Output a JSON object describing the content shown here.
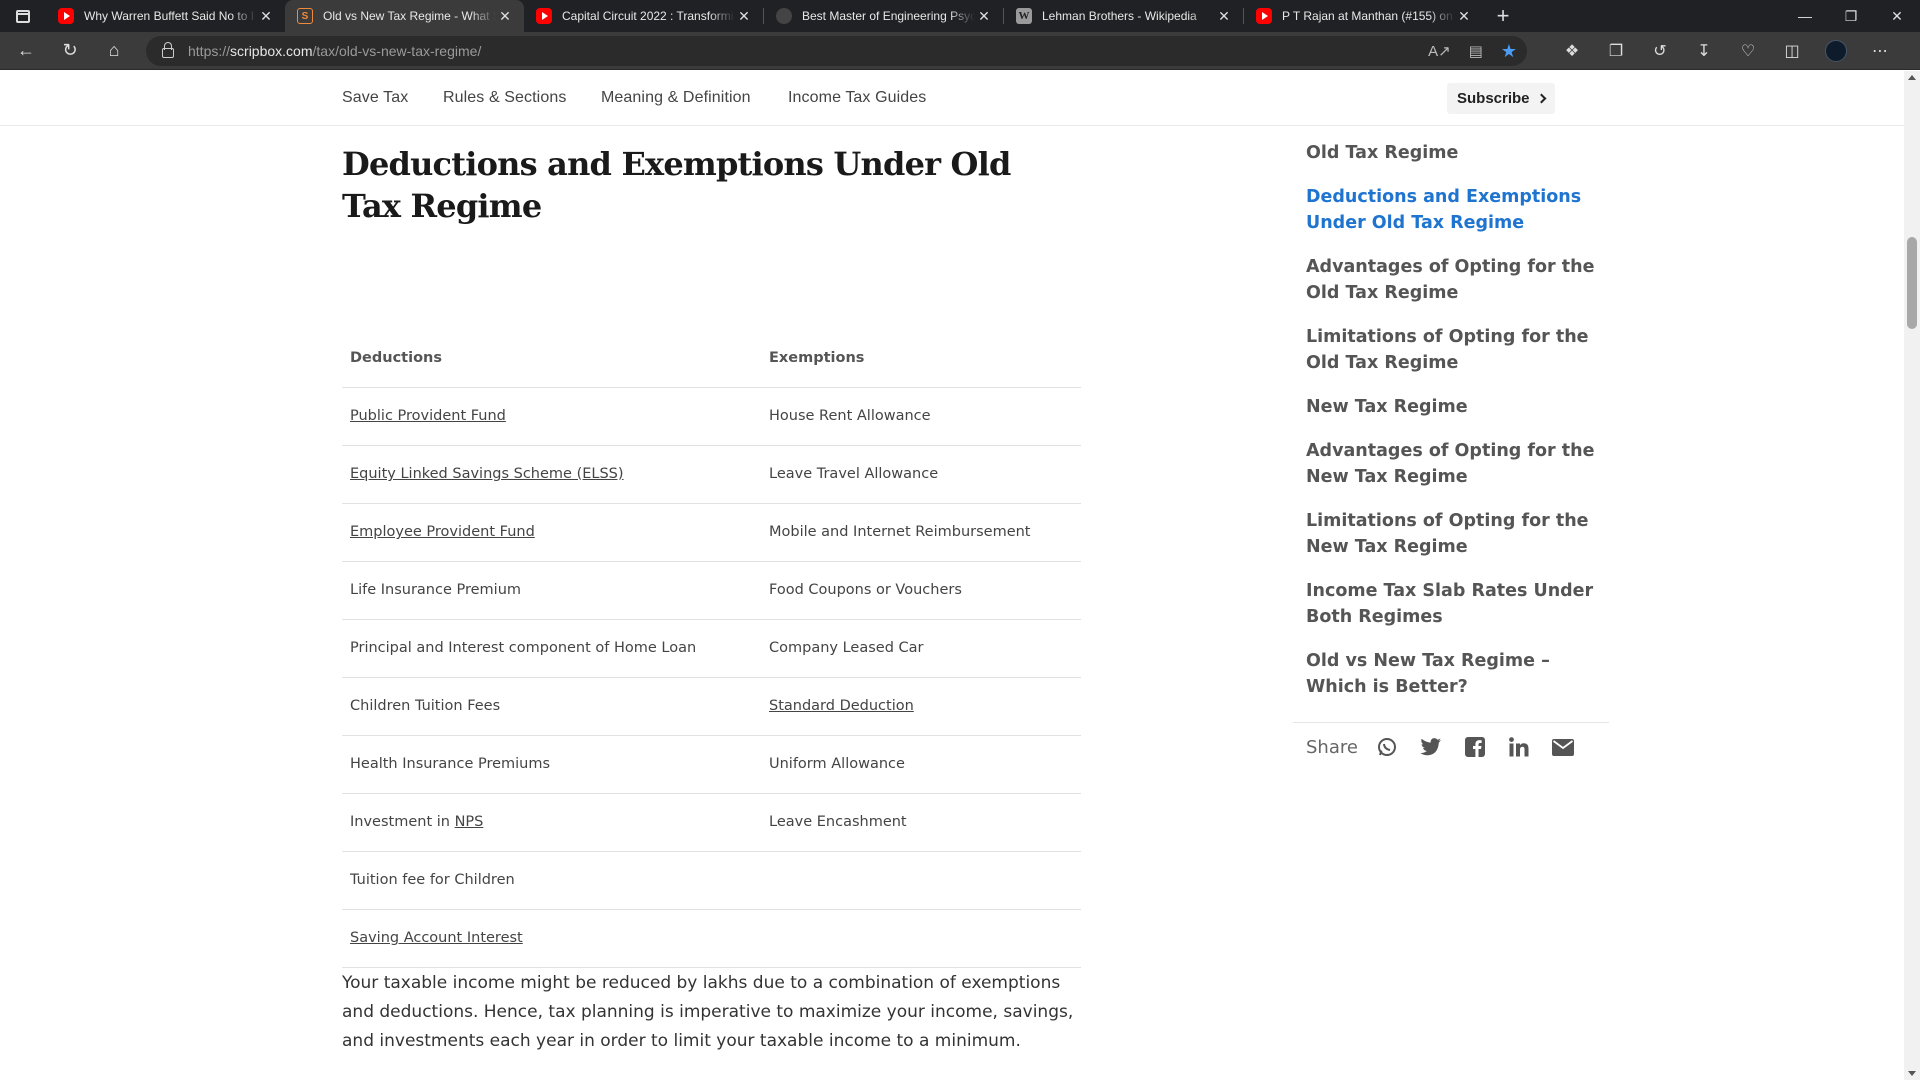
{
  "browser": {
    "tabs": [
      {
        "title": "Why Warren Buffett Said No to I",
        "favicon": "youtube-icon",
        "active": false
      },
      {
        "title": "Old vs New Tax Regime - What S",
        "favicon": "scripbox-icon",
        "active": true
      },
      {
        "title": "Capital Circuit 2022 : Transformi",
        "favicon": "youtube-icon",
        "active": false
      },
      {
        "title": "Best Master of Engineering Psych",
        "favicon": "site-icon",
        "active": false
      },
      {
        "title": "Lehman Brothers - Wikipedia",
        "favicon": "wikipedia-icon",
        "active": false
      },
      {
        "title": "P T Rajan at Manthan (#155) on",
        "favicon": "youtube-icon",
        "active": false
      }
    ],
    "url_prefix": "https://",
    "url_host": "scripbox.com",
    "url_path": "/tax/old-vs-new-tax-regime/",
    "colors": {
      "chrome_dark": "#202124",
      "chrome_mid": "#3b3b3b",
      "accent_star": "#4a9cf5"
    }
  },
  "site_nav": {
    "items": [
      "Save Tax",
      "Rules & Sections",
      "Meaning & Definition",
      "Income Tax Guides"
    ],
    "subscribe_label": "Subscribe"
  },
  "article": {
    "title": "Deductions and Exemptions Under Old Tax Regime",
    "table": {
      "headers": [
        "Deductions",
        "Exemptions"
      ],
      "rows": [
        {
          "deduction": "Public Provident Fund",
          "deduction_link": true,
          "exemption": "House Rent Allowance",
          "exemption_link": false
        },
        {
          "deduction": "Equity Linked Savings Scheme (ELSS)",
          "deduction_link": true,
          "exemption": "Leave Travel Allowance",
          "exemption_link": false
        },
        {
          "deduction": "Employee Provident Fund",
          "deduction_link": true,
          "exemption": "Mobile and Internet Reimbursement",
          "exemption_link": false
        },
        {
          "deduction": "Life Insurance Premium",
          "deduction_link": false,
          "exemption": "Food Coupons or Vouchers",
          "exemption_link": false
        },
        {
          "deduction": "Principal and Interest component of Home Loan",
          "deduction_link": false,
          "exemption": "Company Leased Car",
          "exemption_link": false
        },
        {
          "deduction": "Children Tuition Fees",
          "deduction_link": false,
          "exemption": "Standard Deduction",
          "exemption_link": true
        },
        {
          "deduction": "Health Insurance Premiums",
          "deduction_link": false,
          "exemption": "Uniform Allowance",
          "exemption_link": false
        },
        {
          "deduction_prefix": "Investment in ",
          "deduction": "NPS",
          "deduction_link": true,
          "exemption": "Leave Encashment",
          "exemption_link": false
        },
        {
          "deduction": "Tuition fee for Children",
          "deduction_link": false,
          "exemption": "",
          "exemption_link": false
        },
        {
          "deduction": "Saving Account Interest",
          "deduction_link": true,
          "exemption": "",
          "exemption_link": false
        }
      ]
    },
    "paragraph": "Your taxable income might be reduced by lakhs due to a combination of exemptions and deductions. Hence, tax planning is imperative  to maximize your income, savings, and investments each year in order to limit your taxable income to a minimum."
  },
  "toc": {
    "items": [
      {
        "label": "Old Tax Regime",
        "active": false
      },
      {
        "label": "Deductions and Exemptions Under Old Tax Regime",
        "active": true
      },
      {
        "label": "Advantages of Opting for the Old Tax Regime",
        "active": false
      },
      {
        "label": "Limitations of Opting for the Old Tax Regime",
        "active": false
      },
      {
        "label": "New Tax Regime",
        "active": false
      },
      {
        "label": "Advantages of Opting for the New Tax Regime",
        "active": false
      },
      {
        "label": "Limitations of Opting for the New Tax Regime",
        "active": false
      },
      {
        "label": "Income Tax Slab Rates Under Both Regimes",
        "active": false
      },
      {
        "label": "Old vs New Tax Regime – Which is Better?",
        "active": false
      }
    ],
    "active_color": "#1f74d0",
    "share_label": "Share",
    "share_icons": [
      "whatsapp-icon",
      "twitter-icon",
      "facebook-icon",
      "linkedin-icon",
      "email-icon"
    ]
  }
}
